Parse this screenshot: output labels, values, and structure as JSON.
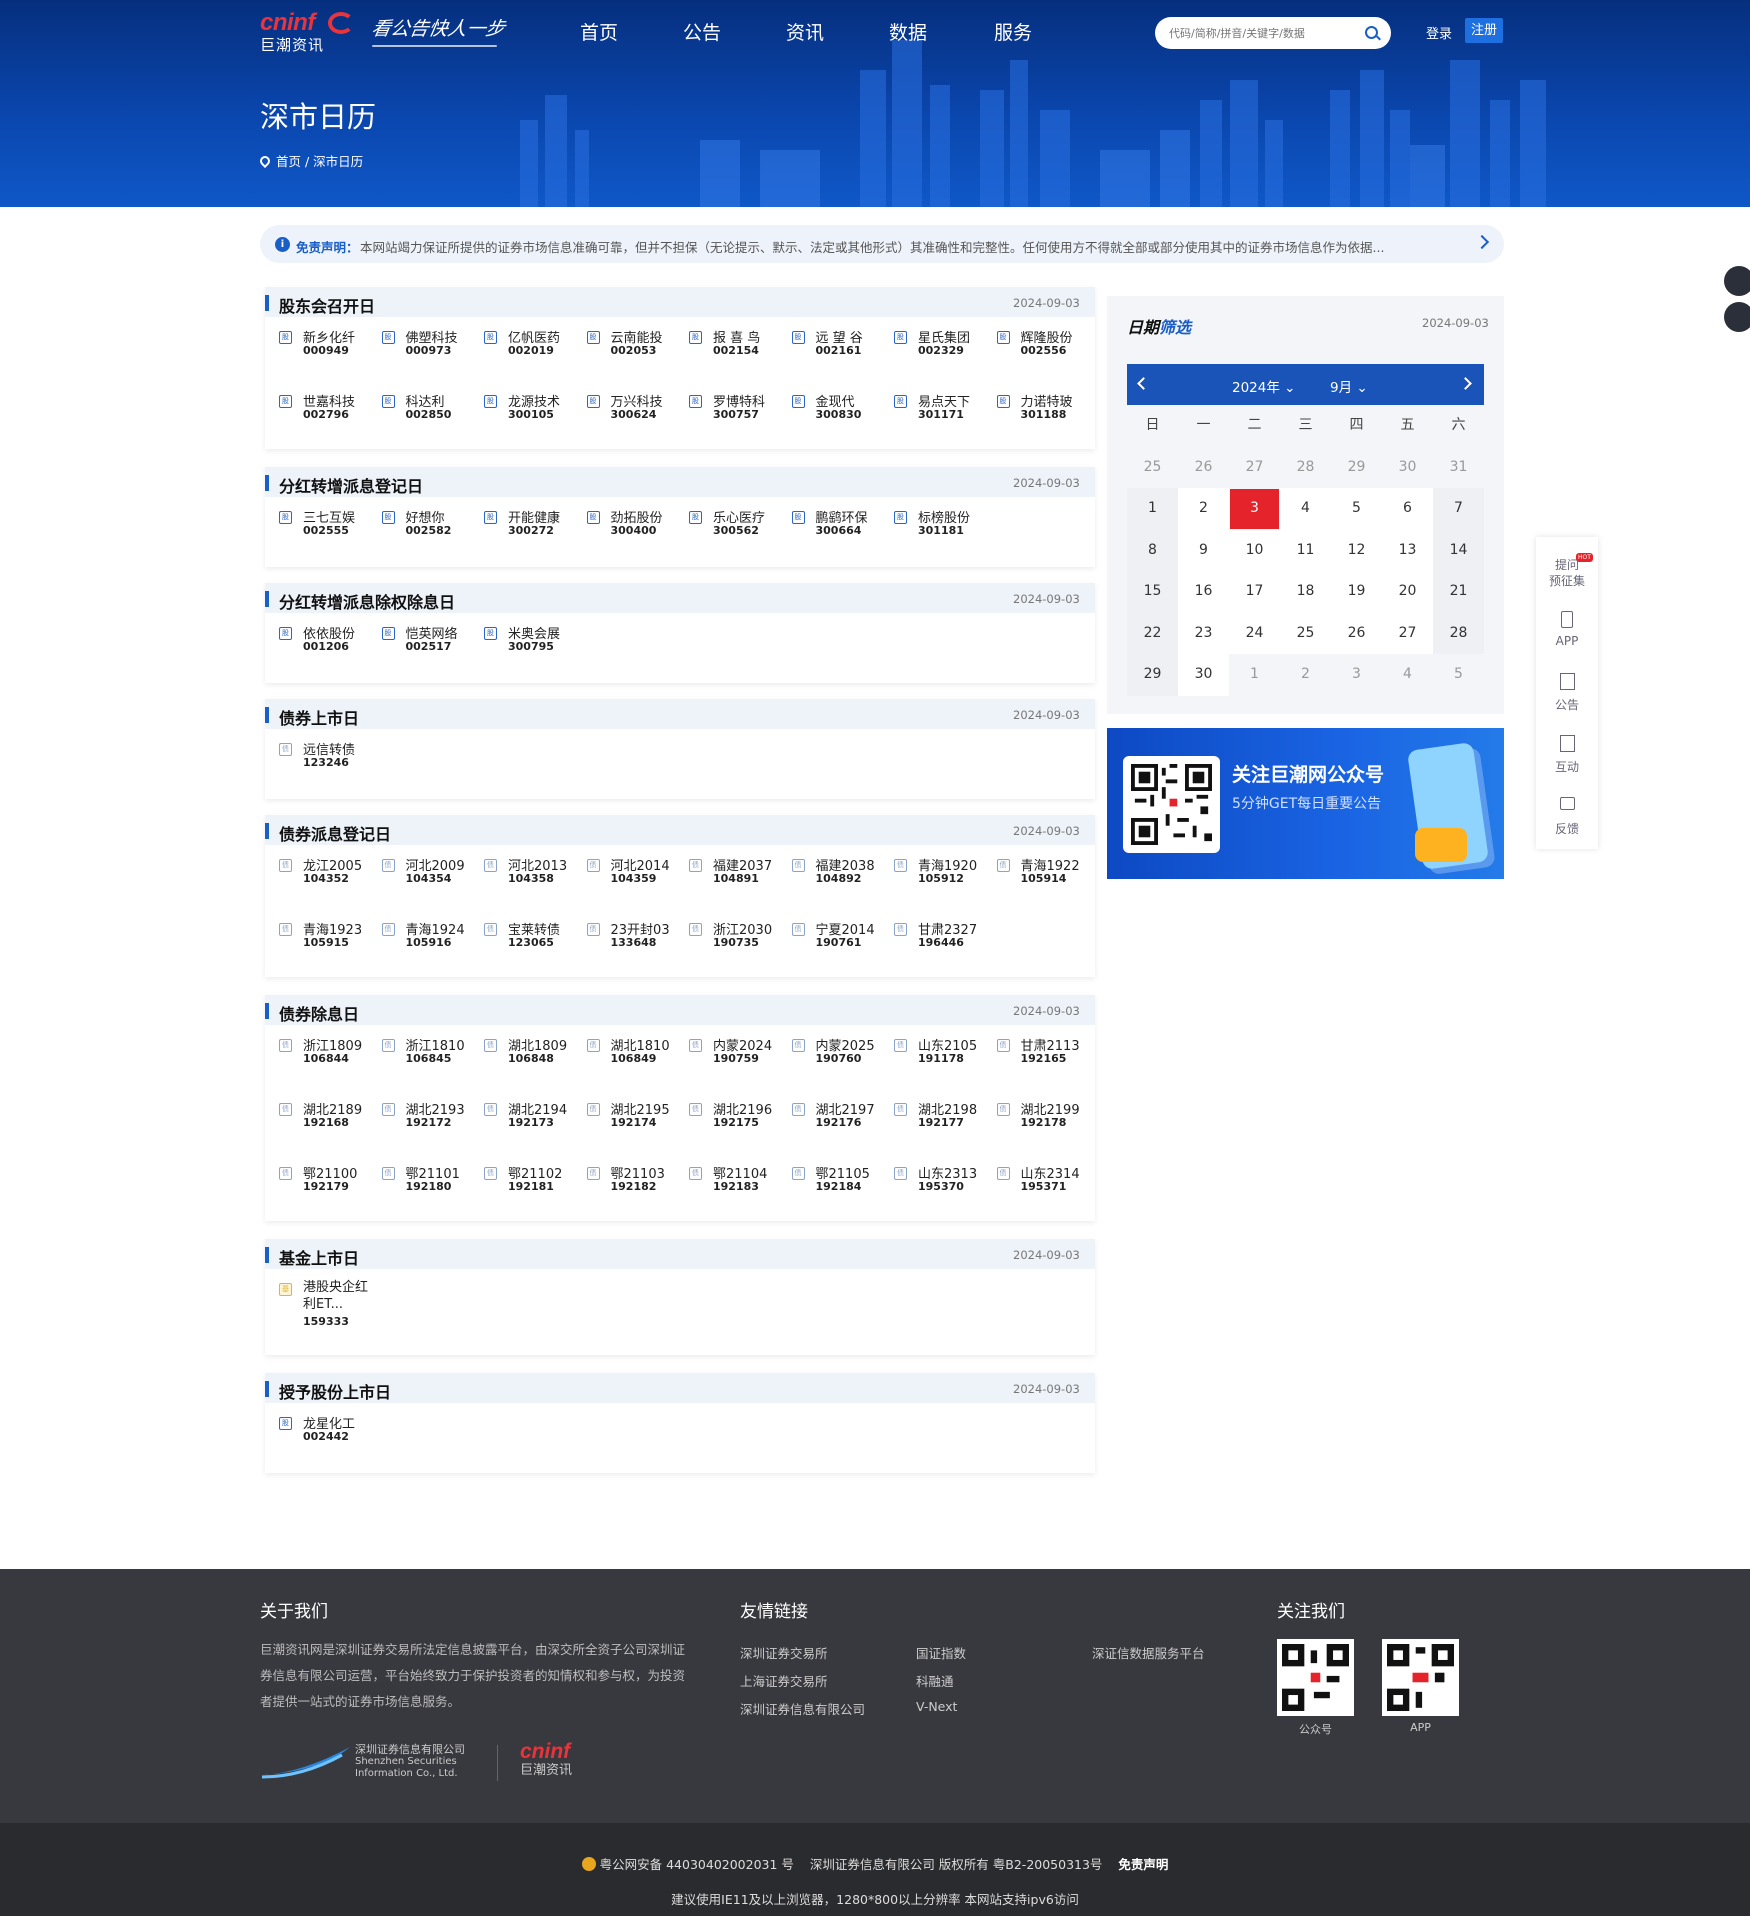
{
  "header": {
    "logo_text": "cninf",
    "logo_cn": "巨潮资讯",
    "slogan": "看公告快人一步",
    "nav": [
      "首页",
      "公告",
      "资讯",
      "数据",
      "服务"
    ],
    "search_placeholder": "代码/简称/拼音/关键字/数据",
    "login": "登录",
    "register": "注册",
    "page_title": "深市日历",
    "breadcrumb": "首页 / 深市日历"
  },
  "notice": {
    "label": "免责声明：",
    "text": "本网站竭力保证所提供的证券市场信息准确可靠，但并不担保（无论提示、默示、法定或其他形式）其准确性和完整性。任何使用方不得就全部或部分使用其中的证券市场信息作为依据..."
  },
  "sections": [
    {
      "title": "股东会召开日",
      "date": "2024-09-03",
      "type": "股",
      "items": [
        {
          "name": "新乡化纤",
          "code": "000949"
        },
        {
          "name": "佛塑科技",
          "code": "000973"
        },
        {
          "name": "亿帆医药",
          "code": "002019"
        },
        {
          "name": "云南能投",
          "code": "002053"
        },
        {
          "name": "报 喜 鸟",
          "code": "002154"
        },
        {
          "name": "远 望 谷",
          "code": "002161"
        },
        {
          "name": "星氏集团",
          "code": "002329"
        },
        {
          "name": "辉隆股份",
          "code": "002556"
        },
        {
          "name": "世嘉科技",
          "code": "002796"
        },
        {
          "name": "科达利",
          "code": "002850"
        },
        {
          "name": "龙源技术",
          "code": "300105"
        },
        {
          "name": "万兴科技",
          "code": "300624"
        },
        {
          "name": "罗博特科",
          "code": "300757"
        },
        {
          "name": "金现代",
          "code": "300830"
        },
        {
          "name": "易点天下",
          "code": "301171"
        },
        {
          "name": "力诺特玻",
          "code": "301188"
        }
      ]
    },
    {
      "title": "分红转增派息登记日",
      "date": "2024-09-03",
      "type": "股",
      "items": [
        {
          "name": "三七互娱",
          "code": "002555"
        },
        {
          "name": "好想你",
          "code": "002582"
        },
        {
          "name": "开能健康",
          "code": "300272"
        },
        {
          "name": "劲拓股份",
          "code": "300400"
        },
        {
          "name": "乐心医疗",
          "code": "300562"
        },
        {
          "name": "鹏鹞环保",
          "code": "300664"
        },
        {
          "name": "标榜股份",
          "code": "301181"
        }
      ]
    },
    {
      "title": "分红转增派息除权除息日",
      "date": "2024-09-03",
      "type": "股",
      "items": [
        {
          "name": "依依股份",
          "code": "001206"
        },
        {
          "name": "恺英网络",
          "code": "002517"
        },
        {
          "name": "米奥会展",
          "code": "300795"
        }
      ]
    },
    {
      "title": "债券上市日",
      "date": "2024-09-03",
      "type": "债",
      "items": [
        {
          "name": "远信转债",
          "code": "123246"
        }
      ]
    },
    {
      "title": "债券派息登记日",
      "date": "2024-09-03",
      "type": "债",
      "items": [
        {
          "name": "龙江2005",
          "code": "104352"
        },
        {
          "name": "河北2009",
          "code": "104354"
        },
        {
          "name": "河北2013",
          "code": "104358"
        },
        {
          "name": "河北2014",
          "code": "104359"
        },
        {
          "name": "福建2037",
          "code": "104891"
        },
        {
          "name": "福建2038",
          "code": "104892"
        },
        {
          "name": "青海1920",
          "code": "105912"
        },
        {
          "name": "青海1922",
          "code": "105914"
        },
        {
          "name": "青海1923",
          "code": "105915"
        },
        {
          "name": "青海1924",
          "code": "105916"
        },
        {
          "name": "宝莱转债",
          "code": "123065"
        },
        {
          "name": "23开封03",
          "code": "133648"
        },
        {
          "name": "浙江2030",
          "code": "190735"
        },
        {
          "name": "宁夏2014",
          "code": "190761"
        },
        {
          "name": "甘肃2327",
          "code": "196446"
        }
      ]
    },
    {
      "title": "债券除息日",
      "date": "2024-09-03",
      "type": "债",
      "items": [
        {
          "name": "浙江1809",
          "code": "106844"
        },
        {
          "name": "浙江1810",
          "code": "106845"
        },
        {
          "name": "湖北1809",
          "code": "106848"
        },
        {
          "name": "湖北1810",
          "code": "106849"
        },
        {
          "name": "内蒙2024",
          "code": "190759"
        },
        {
          "name": "内蒙2025",
          "code": "190760"
        },
        {
          "name": "山东2105",
          "code": "191178"
        },
        {
          "name": "甘肃2113",
          "code": "192165"
        },
        {
          "name": "湖北2189",
          "code": "192168"
        },
        {
          "name": "湖北2193",
          "code": "192172"
        },
        {
          "name": "湖北2194",
          "code": "192173"
        },
        {
          "name": "湖北2195",
          "code": "192174"
        },
        {
          "name": "湖北2196",
          "code": "192175"
        },
        {
          "name": "湖北2197",
          "code": "192176"
        },
        {
          "name": "湖北2198",
          "code": "192177"
        },
        {
          "name": "湖北2199",
          "code": "192178"
        },
        {
          "name": "鄂21100",
          "code": "192179"
        },
        {
          "name": "鄂21101",
          "code": "192180"
        },
        {
          "name": "鄂21102",
          "code": "192181"
        },
        {
          "name": "鄂21103",
          "code": "192182"
        },
        {
          "name": "鄂21104",
          "code": "192183"
        },
        {
          "name": "鄂21105",
          "code": "192184"
        },
        {
          "name": "山东2313",
          "code": "195370"
        },
        {
          "name": "山东2314",
          "code": "195371"
        }
      ]
    },
    {
      "title": "基金上市日",
      "date": "2024-09-03",
      "type": "基",
      "items": [
        {
          "name": "港股央企红利ET...",
          "code": "159333"
        }
      ]
    },
    {
      "title": "授予股份上市日",
      "date": "2024-09-03",
      "type": "股",
      "items": [
        {
          "name": "龙星化工",
          "code": "002442"
        }
      ]
    }
  ],
  "calendar": {
    "title_a": "日期",
    "title_b": "筛选",
    "date": "2024-09-03",
    "year": "2024年",
    "month": "9月",
    "weekdays": [
      "日",
      "一",
      "二",
      "三",
      "四",
      "五",
      "六"
    ],
    "days": [
      "25",
      "26",
      "27",
      "28",
      "29",
      "30",
      "31",
      "1",
      "2",
      "3",
      "4",
      "5",
      "6",
      "7",
      "8",
      "9",
      "10",
      "11",
      "12",
      "13",
      "14",
      "15",
      "16",
      "17",
      "18",
      "19",
      "20",
      "21",
      "22",
      "23",
      "24",
      "25",
      "26",
      "27",
      "28",
      "29",
      "30",
      "1",
      "2",
      "3",
      "4",
      "5"
    ],
    "selected": "3"
  },
  "qr_banner": {
    "title": "关注巨潮网公众号",
    "subtitle": "5分钟GET每日重要公告"
  },
  "side_tools": [
    {
      "label": "提问\n预征集",
      "hot": "HOT"
    },
    {
      "label": "APP"
    },
    {
      "label": "公告"
    },
    {
      "label": "互动"
    },
    {
      "label": "反馈"
    }
  ],
  "footer": {
    "about_title": "关于我们",
    "about_text": "巨潮资讯网是深圳证券交易所法定信息披露平台，由深交所全资子公司深圳证券信息有限公司运营，平台始终致力于保护投资者的知情权和参与权，为投资者提供一站式的证券市场信息服务。",
    "links_title": "友情链接",
    "links": [
      "深圳证券交易所",
      "上海证券交易所",
      "深圳证券信息有限公司",
      "国证指数",
      "科融通",
      "V-Next",
      "深证信数据服务平台"
    ],
    "follow_title": "关注我们",
    "qr_labels": [
      "公众号",
      "APP"
    ],
    "company_cn": "深圳证券信息有限公司",
    "company_en1": "Shenzhen Securities",
    "company_en2": "Information Co., Ltd.",
    "logo_text": "cninf",
    "logo_cn": "巨潮资讯"
  },
  "copyright": {
    "line1_a": "粤公网安备 44030402002031 号",
    "line1_b": "深圳证券信息有限公司 版权所有 粤B2-20050313号",
    "line1_c": "免责声明",
    "line2": "建议使用IE11及以上浏览器，1280*800以上分辨率 本网站支持ipv6访问"
  }
}
